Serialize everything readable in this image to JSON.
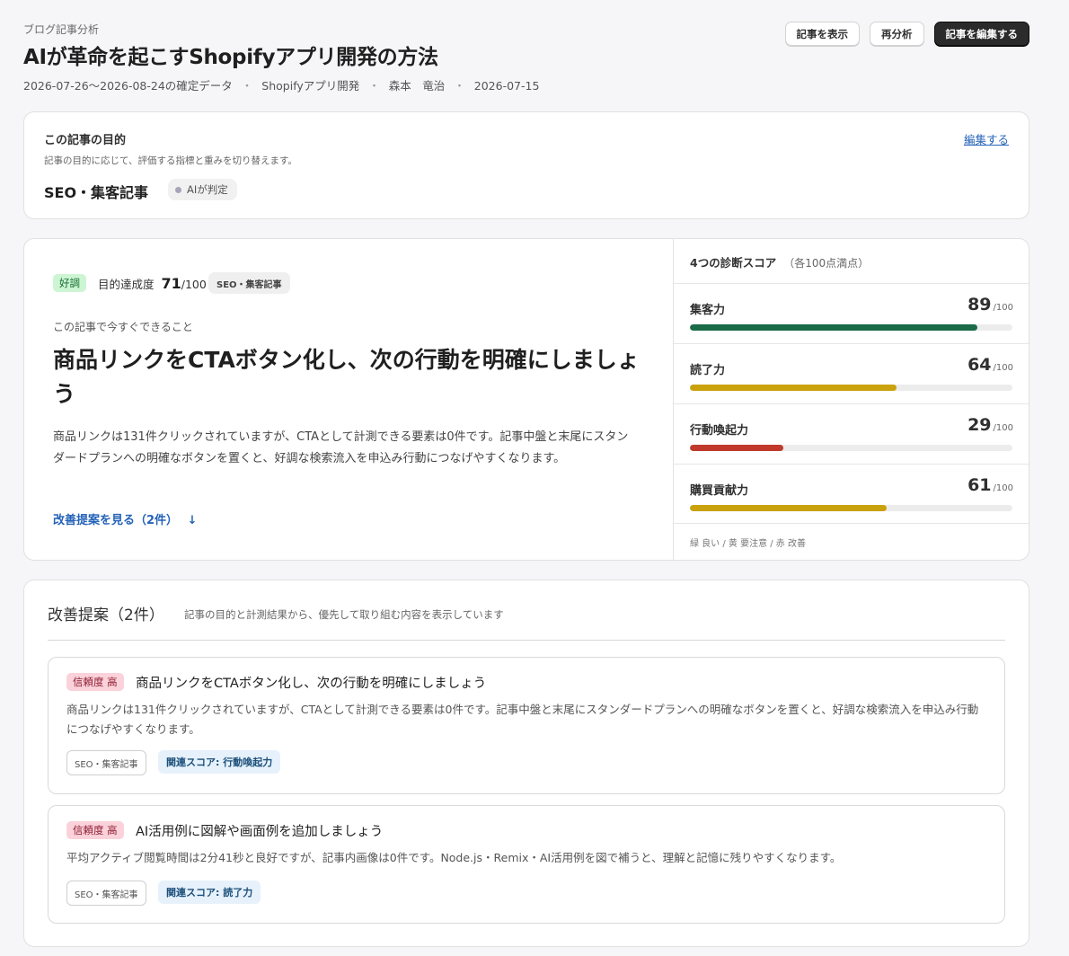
{
  "header": {
    "breadcrumb": "ブログ記事分析",
    "title": "AIが革命を起こすShopifyアプリ開発の方法",
    "meta": {
      "period": "2026-07-26〜2026-08-24の確定データ",
      "category": "Shopifyアプリ開発",
      "author": "森本　竜治",
      "date": "2026-07-15",
      "separator": "・"
    },
    "buttons": {
      "view": "記事を表示",
      "reanalyze": "再分析",
      "edit": "記事を編集する"
    }
  },
  "purpose": {
    "title": "この記事の目的",
    "description": "記事の目的に応じて、評価する指標と重みを切り替えます。",
    "value": "SEO・集客記事",
    "ai_badge": "AIが判定",
    "edit_link": "編集する"
  },
  "summary": {
    "status_badge": "好調",
    "achievement_label": "目的達成度",
    "achievement_value": "71",
    "achievement_max": "/100",
    "purpose_tag": "SEO・集客記事",
    "now_label": "この記事で今すぐできること",
    "headline": "商品リンクをCTAボタン化し、次の行動を明確にしましょう",
    "body": "商品リンクは131件クリックされていますが、CTAとして計測できる要素は0件です。記事中盤と末尾にスタンダードプランへの明確なボタンを置くと、好調な検索流入を申込み行動につなげやすくなります。",
    "more_link": "改善提案を見る（2件）",
    "more_icon": "↓"
  },
  "scores": {
    "title": "4つの診断スコア",
    "subtitle": "（各100点満点）",
    "max_label": "/100",
    "items": [
      {
        "name": "集客力",
        "value": 89,
        "color": "#1a6b48"
      },
      {
        "name": "読了力",
        "value": 64,
        "color": "#c9a20e"
      },
      {
        "name": "行動喚起力",
        "value": 29,
        "color": "#c0392b"
      },
      {
        "name": "購買貢献力",
        "value": 61,
        "color": "#c9a20e"
      }
    ],
    "legend": "緑 良い / 黄 要注意 / 赤 改善"
  },
  "suggestions": {
    "title": "改善提案（2件）",
    "subtitle": "記事の目的と計測結果から、優先して取り組む内容を表示しています",
    "items": [
      {
        "confidence": "信頼度 高",
        "title": "商品リンクをCTAボタン化し、次の行動を明確にしましょう",
        "description": "商品リンクは131件クリックされていますが、CTAとして計測できる要素は0件です。記事中盤と末尾にスタンダードプランへの明確なボタンを置くと、好調な検索流入を申込み行動につなげやすくなります。",
        "tag": "SEO・集客記事",
        "related": "関連スコア: 行動喚起力"
      },
      {
        "confidence": "信頼度 高",
        "title": "AI活用例に図解や画面例を追加しましょう",
        "description": "平均アクティブ閲覧時間は2分41秒と良好ですが、記事内画像は0件です。Node.js・Remix・AI活用例を図で補うと、理解と記憶に残りやすくなります。",
        "tag": "SEO・集客記事",
        "related": "関連スコア: 読了力"
      }
    ]
  }
}
